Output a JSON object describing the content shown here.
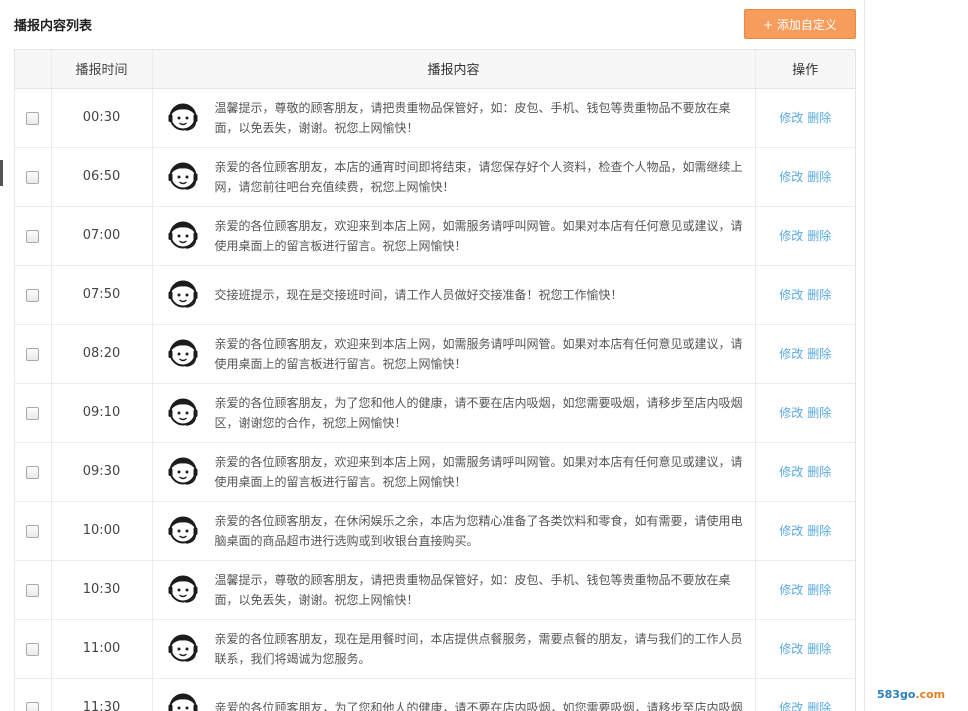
{
  "header": {
    "title": "播报内容列表",
    "add_button_label": "+ 添加自定义"
  },
  "table": {
    "columns": {
      "time": "播报时间",
      "content": "播报内容",
      "ops": "操作"
    },
    "edit_label": "修改",
    "delete_label": "删除",
    "rows": [
      {
        "time": "00:30",
        "content": "温馨提示，尊敬的顾客朋友，请把贵重物品保管好，如：皮包、手机、钱包等贵重物品不要放在桌面，以免丢失，谢谢。祝您上网愉快！"
      },
      {
        "time": "06:50",
        "content": "亲爱的各位顾客朋友，本店的通宵时间即将结束，请您保存好个人资料，检查个人物品，如需继续上网，请您前往吧台充值续费，祝您上网愉快！"
      },
      {
        "time": "07:00",
        "content": "亲爱的各位顾客朋友，欢迎来到本店上网，如需服务请呼叫网管。如果对本店有任何意见或建议，请使用桌面上的留言板进行留言。祝您上网愉快！"
      },
      {
        "time": "07:50",
        "content": "交接班提示，现在是交接班时间，请工作人员做好交接准备！祝您工作愉快！"
      },
      {
        "time": "08:20",
        "content": "亲爱的各位顾客朋友，欢迎来到本店上网，如需服务请呼叫网管。如果对本店有任何意见或建议，请使用桌面上的留言板进行留言。祝您上网愉快！"
      },
      {
        "time": "09:10",
        "content": "亲爱的各位顾客朋友，为了您和他人的健康，请不要在店内吸烟，如您需要吸烟，请移步至店内吸烟区，谢谢您的合作，祝您上网愉快！"
      },
      {
        "time": "09:30",
        "content": "亲爱的各位顾客朋友，欢迎来到本店上网，如需服务请呼叫网管。如果对本店有任何意见或建议，请使用桌面上的留言板进行留言。祝您上网愉快！"
      },
      {
        "time": "10:00",
        "content": "亲爱的各位顾客朋友，在休闲娱乐之余，本店为您精心准备了各类饮料和零食，如有需要，请使用电脑桌面的商品超市进行选购或到收银台直接购买。"
      },
      {
        "time": "10:30",
        "content": "温馨提示，尊敬的顾客朋友，请把贵重物品保管好，如：皮包、手机、钱包等贵重物品不要放在桌面，以免丢失，谢谢。祝您上网愉快！"
      },
      {
        "time": "11:00",
        "content": "亲爱的各位顾客朋友，现在是用餐时间，本店提供点餐服务，需要点餐的朋友，请与我们的工作人员联系，我们将竭诚为您服务。"
      },
      {
        "time": "11:30",
        "content": "亲爱的各位顾客朋友，为了您和他人的健康，请不要在店内吸烟，如您需要吸烟，请移步至店内吸烟"
      }
    ]
  },
  "icons": {
    "row_avatar": "headset-operator-icon"
  },
  "colors": {
    "accent_button": "#f89c5c",
    "link": "#5aa9de"
  },
  "watermark": {
    "text": "583go",
    "suffix": ".com"
  }
}
